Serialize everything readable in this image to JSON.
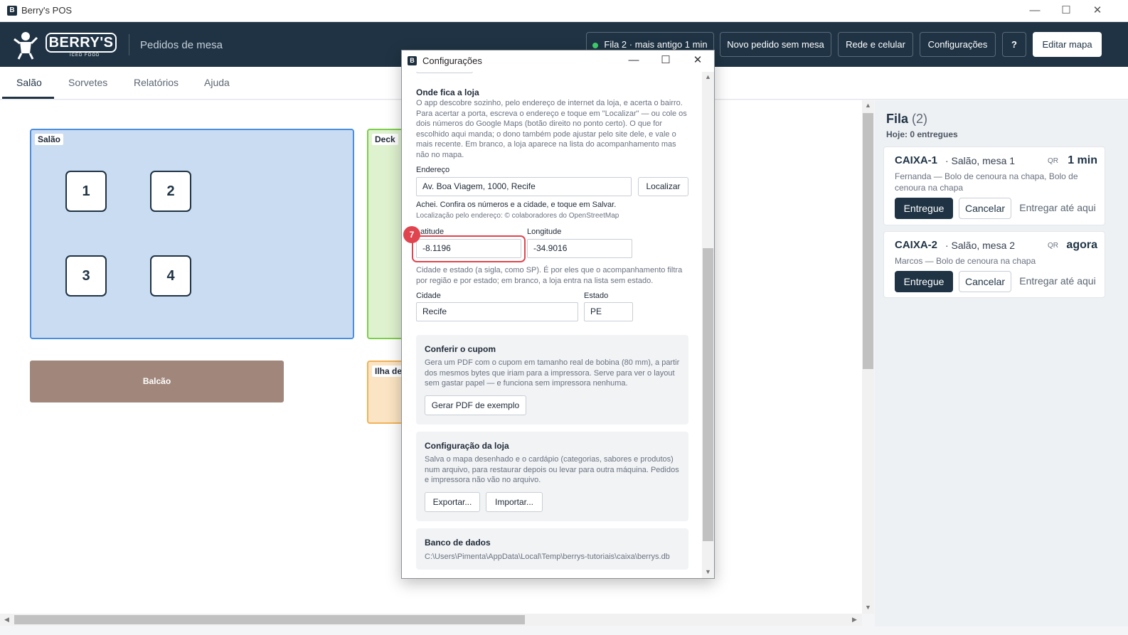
{
  "window": {
    "title": "Berry's POS",
    "app_icon": "berrys-app-icon",
    "controls": [
      "minimize",
      "maximize",
      "close"
    ]
  },
  "header": {
    "brand": "BERRY'S",
    "brand_sub": "ICED FOOD",
    "page_title": "Pedidos de mesa",
    "buttons": {
      "queue_status": "Fila 2 · mais antigo 1 min",
      "new_order": "Novo pedido sem mesa",
      "network": "Rede e celular",
      "settings": "Configurações",
      "help": "?",
      "edit_map": "Editar mapa"
    }
  },
  "tabs": [
    {
      "label": "Salão",
      "active": true
    },
    {
      "label": "Sorvetes",
      "active": false
    },
    {
      "label": "Relatórios",
      "active": false
    },
    {
      "label": "Ajuda",
      "active": false
    }
  ],
  "floor": {
    "zones": [
      {
        "name": "Salão",
        "color": "#c9dcf2",
        "border": "#4a8ee0"
      },
      {
        "name": "Deck",
        "color": "#dff2cf",
        "border": "#7ccf4a"
      },
      {
        "name": "Ilha de",
        "color": "#fbe4c3",
        "border": "#f2b257"
      }
    ],
    "tables": [
      "1",
      "2",
      "3",
      "4"
    ],
    "counter": "Balcão"
  },
  "queue": {
    "title": "Fila",
    "count": "(2)",
    "subtitle": "Hoje: 0 entregues",
    "orders": [
      {
        "code": "CAIXA-1",
        "where": "· Salão, mesa 1",
        "qr": "QR",
        "time": "1 min",
        "desc": "Fernanda — Bolo de cenoura na chapa, Bolo de cenoura na chapa",
        "actions": {
          "deliver": "Entregue",
          "cancel": "Cancelar",
          "deliver_until": "Entregar até aqui"
        }
      },
      {
        "code": "CAIXA-2",
        "where": "· Salão, mesa 2",
        "qr": "QR",
        "time": "agora",
        "desc": "Marcos — Bolo de cenoura na chapa",
        "actions": {
          "deliver": "Entregue",
          "cancel": "Cancelar",
          "deliver_until": "Entregar até aqui"
        }
      }
    ]
  },
  "dialog": {
    "title": "Configurações",
    "location": {
      "title": "Onde fica a loja",
      "help": "O app descobre sozinho, pelo endereço de internet da loja, e acerta o bairro. Para acertar a porta, escreva o endereço e toque em \"Localizar\" — ou cole os dois números do Google Maps (botão direito no ponto certo). O que for escolhido aqui manda; o dono também pode ajustar pelo site dele, e vale o mais recente. Em branco, a loja aparece na lista do acompanhamento mas não no mapa.",
      "address_label": "Endereço",
      "address_value": "Av. Boa Viagem, 1000, Recife",
      "locate_button": "Localizar",
      "found_msg": "Achei. Confira os números e a cidade, e toque em Salvar.",
      "attribution": "Localização pelo endereço: © colaboradores do OpenStreetMap",
      "latitude_label": "Latitude",
      "latitude_value": "-8.1196",
      "longitude_label": "Longitude",
      "longitude_value": "-34.9016",
      "city_help": "Cidade e estado (a sigla, como SP). É por eles que o acompanhamento filtra por região e por estado; em branco, a loja entra na lista sem estado.",
      "city_label": "Cidade",
      "city_value": "Recife",
      "state_label": "Estado",
      "state_value": "PE"
    },
    "coupon": {
      "title": "Conferir o cupom",
      "help": "Gera um PDF com o cupom em tamanho real de bobina (80 mm), a partir dos mesmos bytes que iriam para a impressora. Serve para ver o layout sem gastar papel — e funciona sem impressora nenhuma.",
      "button": "Gerar PDF de exemplo"
    },
    "store_config": {
      "title": "Configuração da loja",
      "help": "Salva o mapa desenhado e o cardápio (categorias, sabores e produtos) num arquivo, para restaurar depois ou levar para outra máquina. Pedidos e impressora não vão no arquivo.",
      "export": "Exportar...",
      "import": "Importar..."
    },
    "database": {
      "title": "Banco de dados",
      "path": "C:\\Users\\Pimenta\\AppData\\Local\\Temp\\berrys-tutoriais\\caixa\\berrys.db"
    }
  },
  "tutorial": {
    "step": "7",
    "color": "#e0454f"
  }
}
